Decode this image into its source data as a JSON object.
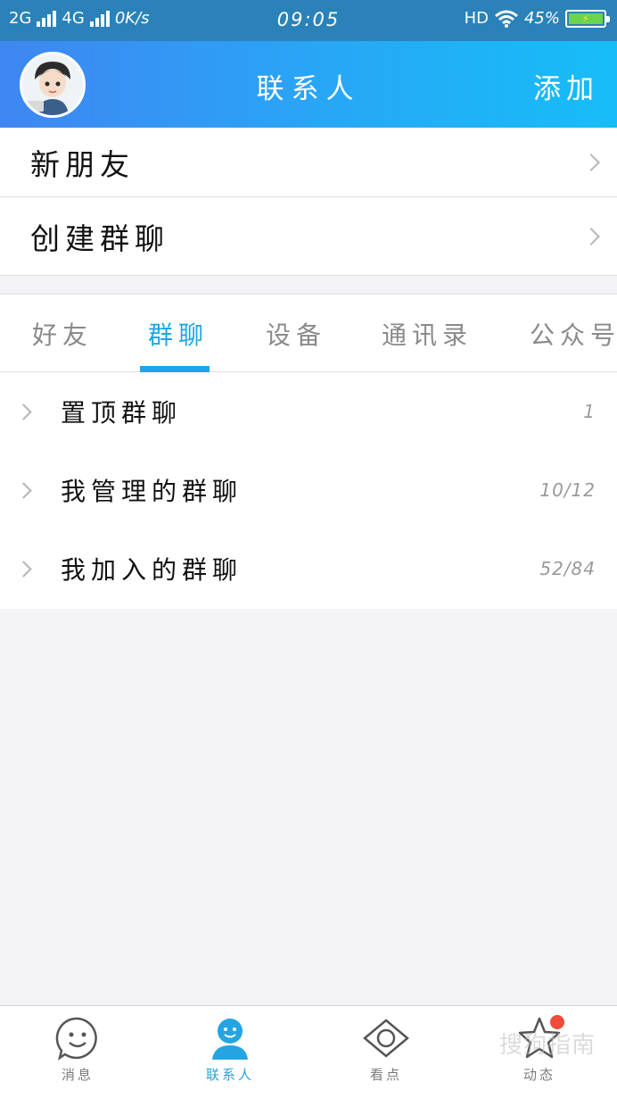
{
  "status_bar": {
    "network1": "2G",
    "network2": "4G",
    "speed": "0K/s",
    "time": "09:05",
    "hd": "HD",
    "battery": "45%"
  },
  "header": {
    "title": "联系人",
    "add_label": "添加"
  },
  "top_list": [
    {
      "label": "新朋友"
    },
    {
      "label": "创建群聊"
    }
  ],
  "tabs": [
    {
      "label": "好友",
      "active": false
    },
    {
      "label": "群聊",
      "active": true
    },
    {
      "label": "设备",
      "active": false
    },
    {
      "label": "通讯录",
      "active": false
    },
    {
      "label": "公众号",
      "active": false
    }
  ],
  "groups": [
    {
      "name": "置顶群聊",
      "count": "1"
    },
    {
      "name": "我管理的群聊",
      "count": "10/12"
    },
    {
      "name": "我加入的群聊",
      "count": "52/84"
    }
  ],
  "bottom_nav": [
    {
      "label": "消息",
      "icon": "smile-icon",
      "active": false
    },
    {
      "label": "联系人",
      "icon": "contact-icon",
      "active": true
    },
    {
      "label": "看点",
      "icon": "eye-icon",
      "active": false
    },
    {
      "label": "动态",
      "icon": "star-icon",
      "active": false
    }
  ],
  "watermark": "搜狗指南",
  "colors": {
    "accent": "#1da7e2",
    "header_start": "#3f86f2",
    "header_end": "#16bdf7",
    "badge": "#ef4a3b"
  }
}
